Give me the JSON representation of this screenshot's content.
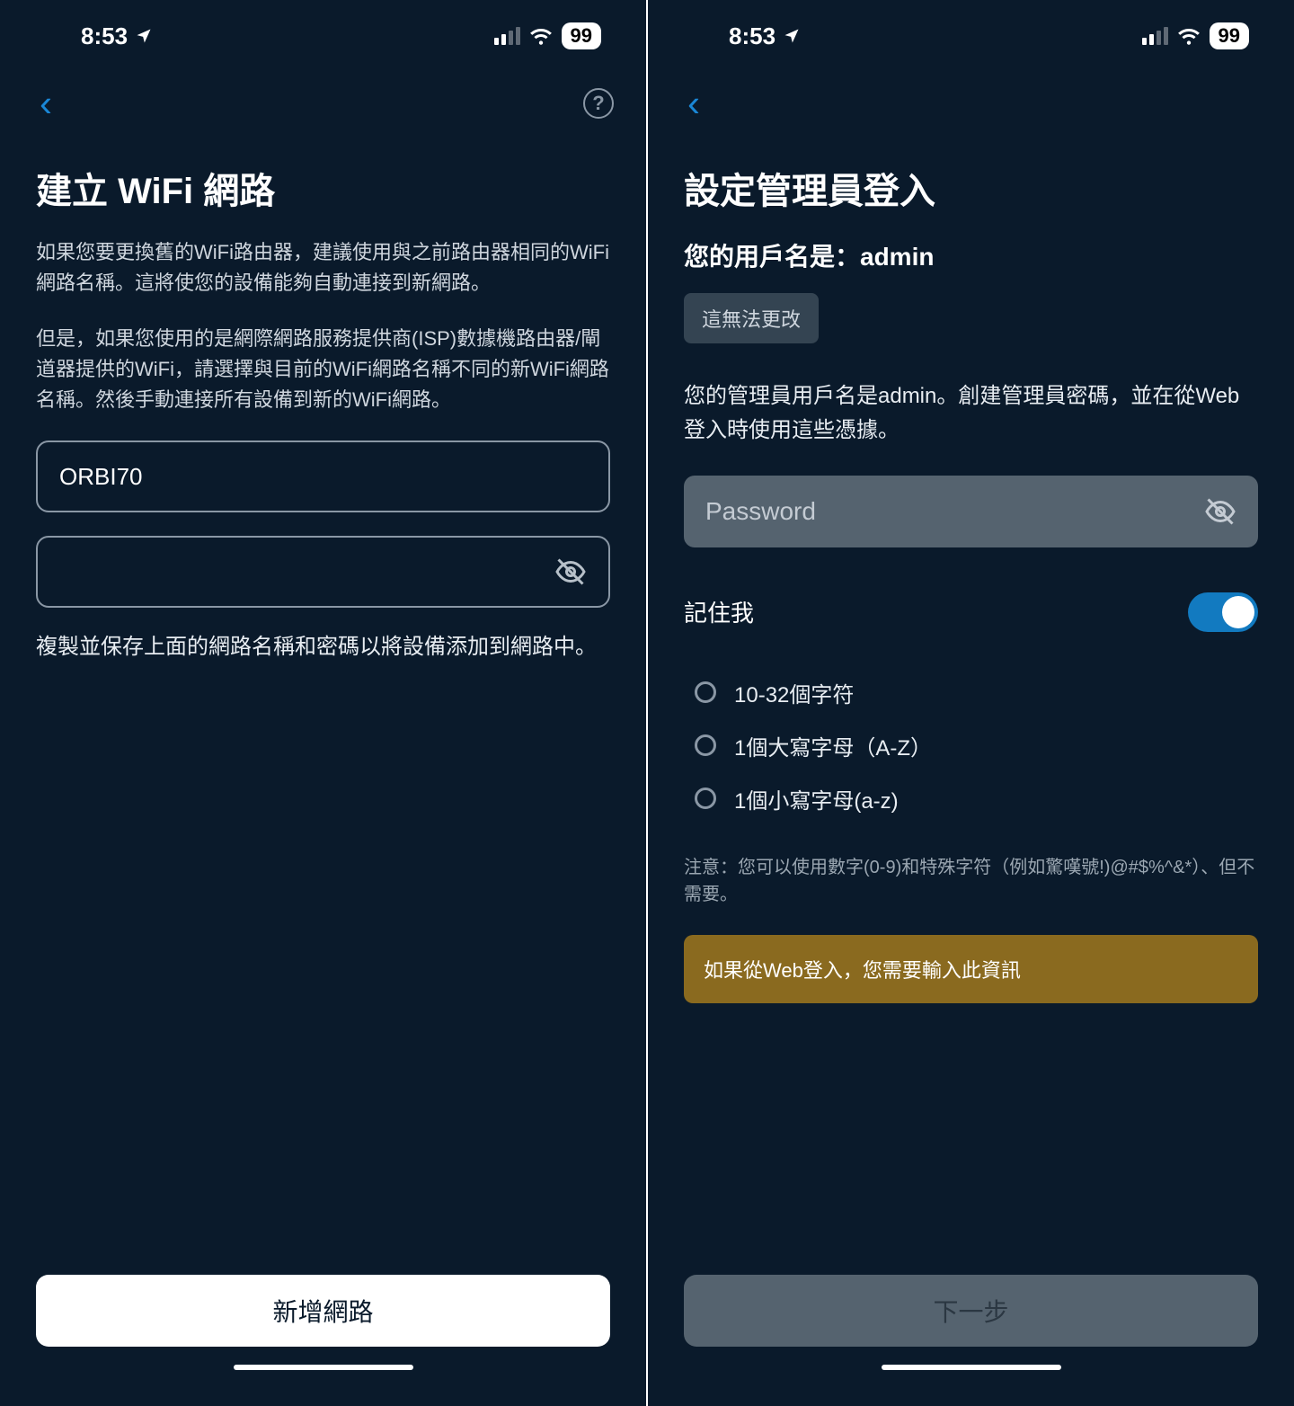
{
  "status": {
    "time": "8:53",
    "battery": "99"
  },
  "left": {
    "title": "建立 WiFi 網路",
    "para1": "如果您要更換舊的WiFi路由器，建議使用與之前路由器相同的WiFi網路名稱。這將使您的設備能夠自動連接到新網路。",
    "para2": "但是，如果您使用的是網際網路服務提供商(ISP)數據機路由器/閘道器提供的WiFi，請選擇與目前的WiFi網路名稱不同的新WiFi網路名稱。然後手動連接所有設備到新的WiFi網路。",
    "ssid_value": "ORBI70",
    "password_value": "",
    "note": "複製並保存上面的網路名稱和密碼以將設備添加到網路中。",
    "button": "新增網路"
  },
  "right": {
    "title": "設定管理員登入",
    "subtitle": "您的用戶名是：admin",
    "chip": "這無法更改",
    "desc": "您的管理員用戶名是admin。創建管理員密碼，並在從Web登入時使用這些憑據。",
    "password_placeholder": "Password",
    "remember_label": "記住我",
    "remember_on": true,
    "rules": [
      "10-32個字符",
      "1個大寫字母（A-Z）",
      "1個小寫字母(a-z)"
    ],
    "small_note": "注意：您可以使用數字(0-9)和特殊字符（例如驚嘆號!)@#$%^&*）、但不需要。",
    "banner": "如果從Web登入，您需要輸入此資訊",
    "button": "下一步"
  }
}
